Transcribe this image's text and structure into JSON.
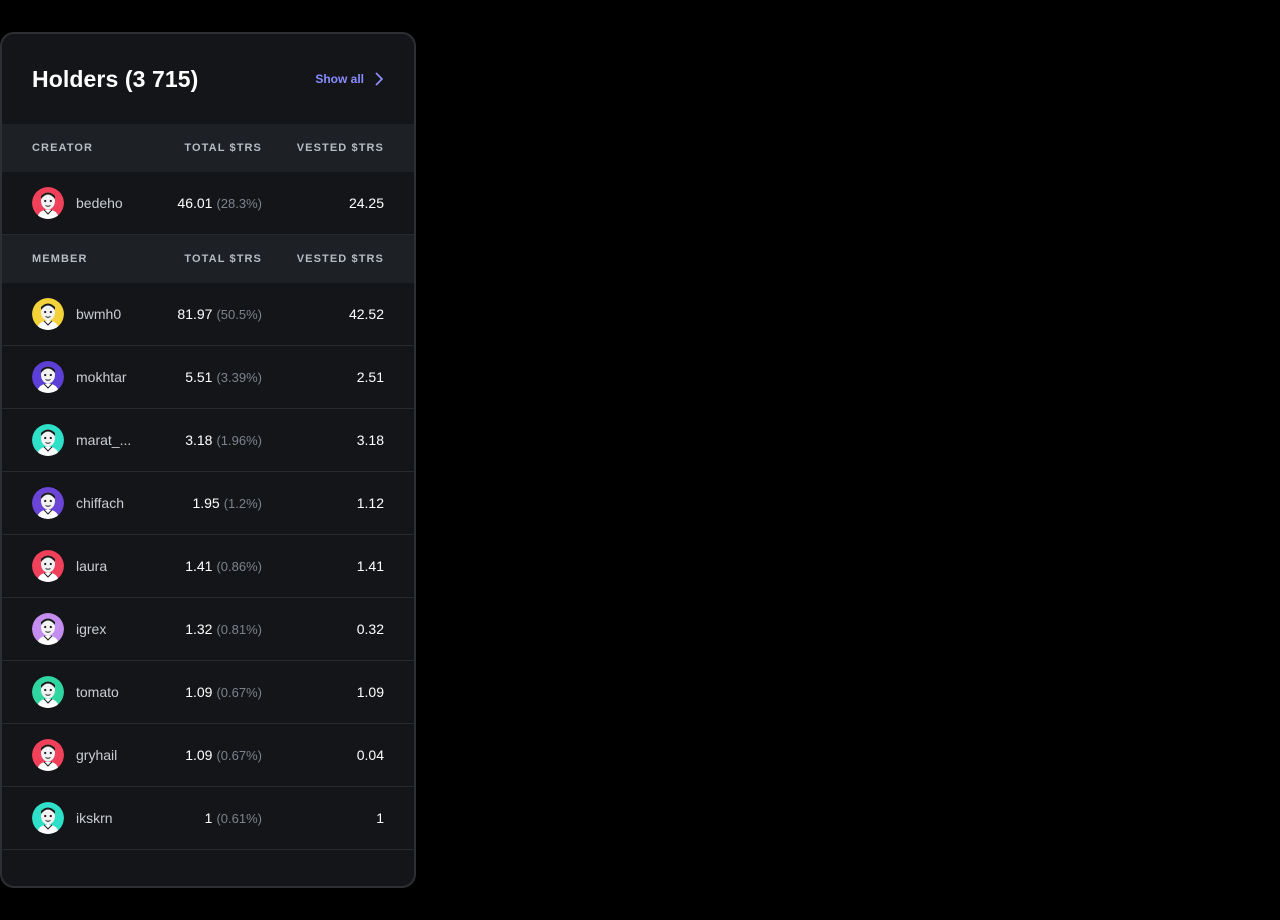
{
  "header": {
    "title": "Holders (3 715)",
    "show_all_label": "Show all"
  },
  "creator_section": {
    "col_member": "CREATOR",
    "col_total": "TOTAL $TRS",
    "col_vested": "VESTED $TRS",
    "rows": [
      {
        "handle": "bedeho",
        "total": "46.01",
        "pct": "(28.3%)",
        "vested": "24.25",
        "avatar_color": "#f0405a",
        "avatar_icon": "avatar-portrait-icon"
      }
    ]
  },
  "member_section": {
    "col_member": "MEMBER",
    "col_total": "TOTAL $TRS",
    "col_vested": "VESTED $TRS",
    "rows": [
      {
        "handle": "bwmh0",
        "total": "81.97",
        "pct": "(50.5%)",
        "vested": "42.52",
        "avatar_color": "#f5d23a",
        "avatar_icon": "avatar-portrait-icon"
      },
      {
        "handle": "mokhtar",
        "total": "5.51",
        "pct": "(3.39%)",
        "vested": "2.51",
        "avatar_color": "#5b3fd6",
        "avatar_icon": "avatar-portrait-icon"
      },
      {
        "handle": "marat_...",
        "total": "3.18",
        "pct": "(1.96%)",
        "vested": "3.18",
        "avatar_color": "#2ee0c8",
        "avatar_icon": "avatar-portrait-icon"
      },
      {
        "handle": "chiffach",
        "total": "1.95",
        "pct": "(1.2%)",
        "vested": "1.12",
        "avatar_color": "#6a45d8",
        "avatar_icon": "avatar-portrait-icon"
      },
      {
        "handle": "laura",
        "total": "1.41",
        "pct": "(0.86%)",
        "vested": "1.41",
        "avatar_color": "#f0405a",
        "avatar_icon": "avatar-portrait-icon"
      },
      {
        "handle": "igrex",
        "total": "1.32",
        "pct": "(0.81%)",
        "vested": "0.32",
        "avatar_color": "#c48ef0",
        "avatar_icon": "avatar-portrait-icon"
      },
      {
        "handle": "tomato",
        "total": "1.09",
        "pct": "(0.67%)",
        "vested": "1.09",
        "avatar_color": "#2fd6a0",
        "avatar_icon": "avatar-portrait-icon"
      },
      {
        "handle": "gryhail",
        "total": "1.09",
        "pct": "(0.67%)",
        "vested": "0.04",
        "avatar_color": "#f0405a",
        "avatar_icon": "avatar-portrait-icon"
      },
      {
        "handle": "ikskrn",
        "total": "1",
        "pct": "(0.61%)",
        "vested": "1",
        "avatar_color": "#2ee0c8",
        "avatar_icon": "avatar-portrait-icon"
      }
    ]
  },
  "colors": {
    "panel_bg": "#141518",
    "header_row_bg": "#1d2024",
    "accent": "#8a8cff",
    "text_primary": "#ffffff",
    "text_muted": "#7c838c"
  }
}
